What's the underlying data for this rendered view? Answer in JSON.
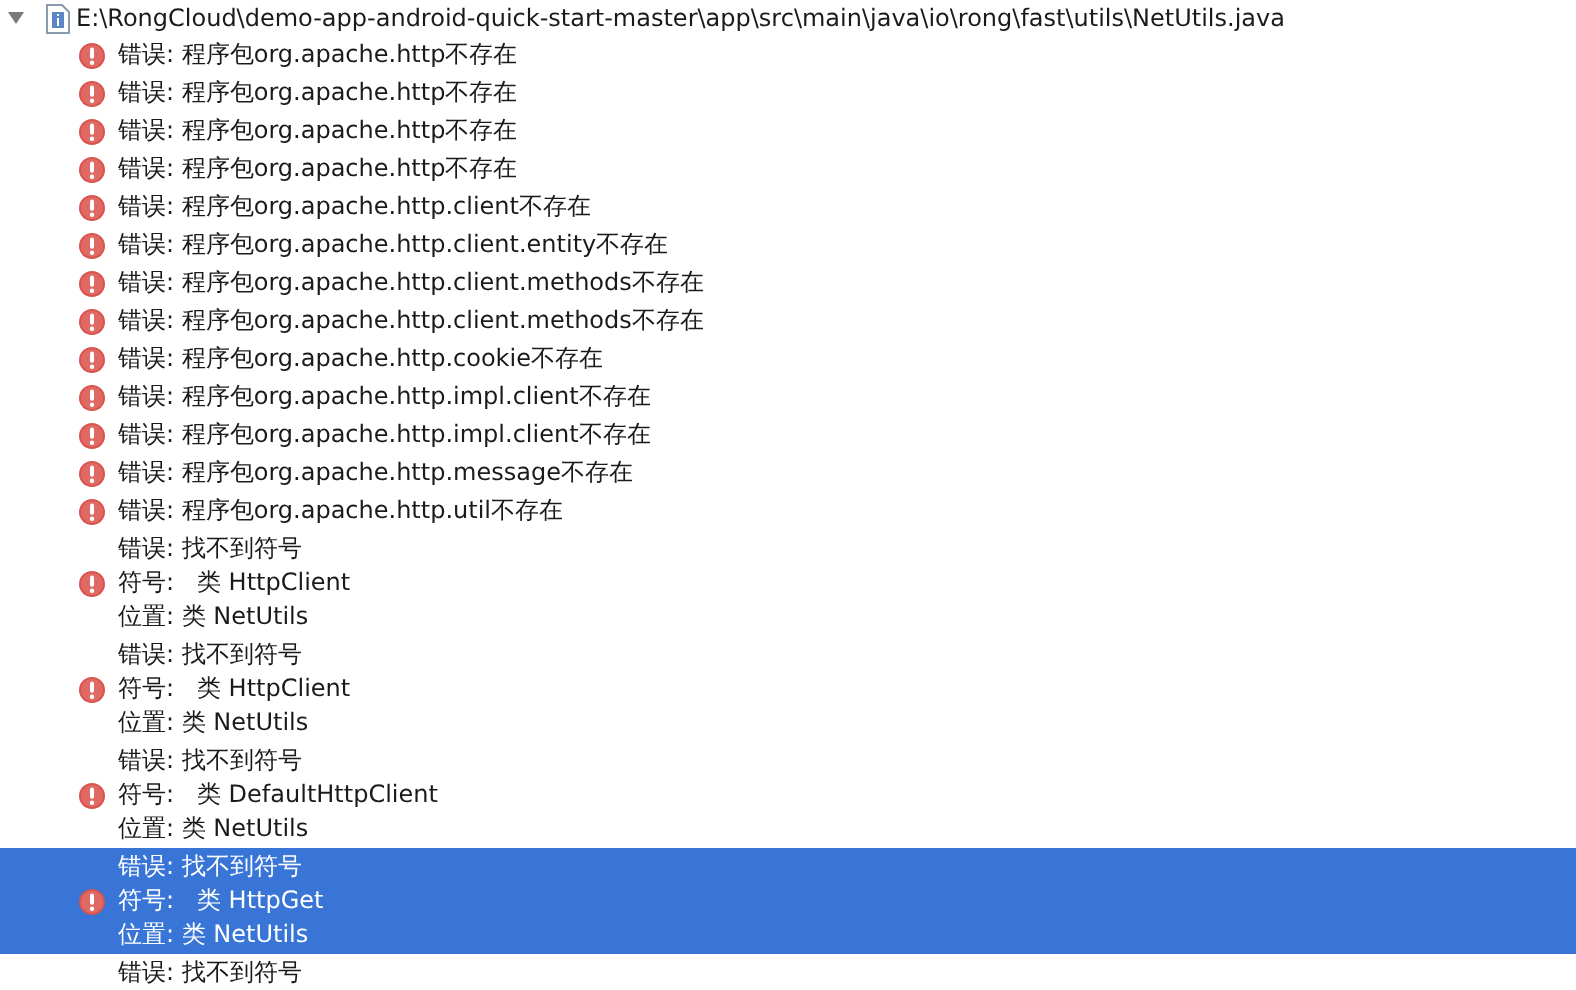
{
  "tree": {
    "file": {
      "path": "E:\\RongCloud\\demo-app-android-quick-start-master\\app\\src\\main\\java\\io\\rong\\fast\\utils\\NetUtils.java",
      "expanded": true
    },
    "messages": [
      {
        "kind": "package",
        "lines": [
          "错误: 程序包org.apache.http不存在"
        ],
        "selected": false
      },
      {
        "kind": "package",
        "lines": [
          "错误: 程序包org.apache.http不存在"
        ],
        "selected": false
      },
      {
        "kind": "package",
        "lines": [
          "错误: 程序包org.apache.http不存在"
        ],
        "selected": false
      },
      {
        "kind": "package",
        "lines": [
          "错误: 程序包org.apache.http不存在"
        ],
        "selected": false
      },
      {
        "kind": "package",
        "lines": [
          "错误: 程序包org.apache.http.client不存在"
        ],
        "selected": false
      },
      {
        "kind": "package",
        "lines": [
          "错误: 程序包org.apache.http.client.entity不存在"
        ],
        "selected": false
      },
      {
        "kind": "package",
        "lines": [
          "错误: 程序包org.apache.http.client.methods不存在"
        ],
        "selected": false
      },
      {
        "kind": "package",
        "lines": [
          "错误: 程序包org.apache.http.client.methods不存在"
        ],
        "selected": false
      },
      {
        "kind": "package",
        "lines": [
          "错误: 程序包org.apache.http.cookie不存在"
        ],
        "selected": false
      },
      {
        "kind": "package",
        "lines": [
          "错误: 程序包org.apache.http.impl.client不存在"
        ],
        "selected": false
      },
      {
        "kind": "package",
        "lines": [
          "错误: 程序包org.apache.http.impl.client不存在"
        ],
        "selected": false
      },
      {
        "kind": "package",
        "lines": [
          "错误: 程序包org.apache.http.message不存在"
        ],
        "selected": false
      },
      {
        "kind": "package",
        "lines": [
          "错误: 程序包org.apache.http.util不存在"
        ],
        "selected": false
      },
      {
        "kind": "symbol",
        "lines": [
          "错误: 找不到符号",
          "符号:   类 HttpClient",
          "位置: 类 NetUtils"
        ],
        "selected": false
      },
      {
        "kind": "symbol",
        "lines": [
          "错误: 找不到符号",
          "符号:   类 HttpClient",
          "位置: 类 NetUtils"
        ],
        "selected": false
      },
      {
        "kind": "symbol",
        "lines": [
          "错误: 找不到符号",
          "符号:   类 DefaultHttpClient",
          "位置: 类 NetUtils"
        ],
        "selected": false
      },
      {
        "kind": "symbol",
        "lines": [
          "错误: 找不到符号",
          "符号:   类 HttpGet",
          "位置: 类 NetUtils"
        ],
        "selected": true
      },
      {
        "kind": "symbol",
        "lines": [
          "错误: 找不到符号"
        ],
        "selected": false
      }
    ]
  }
}
